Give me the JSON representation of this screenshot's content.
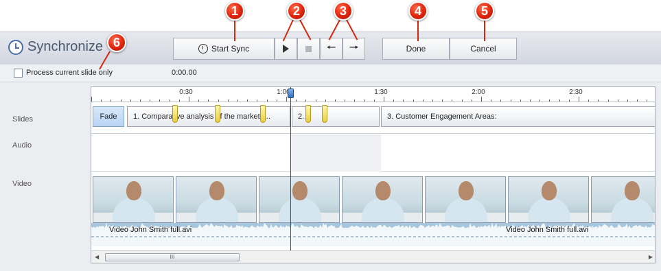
{
  "app": {
    "title": "Synchronize"
  },
  "toolbar": {
    "start_sync_label": "Start Sync",
    "done_label": "Done",
    "cancel_label": "Cancel"
  },
  "process": {
    "checkbox_label": "Process current slide only",
    "checked": false,
    "time": "0:00.00"
  },
  "callouts": [
    "1",
    "2",
    "3",
    "4",
    "5",
    "6"
  ],
  "tracks": {
    "slides": "Slides",
    "audio": "Audio",
    "video": "Video"
  },
  "ruler": {
    "labels": [
      "0:30",
      "1:00",
      "1:30",
      "2:00",
      "2:30"
    ]
  },
  "slides": [
    {
      "label": "Fade"
    },
    {
      "label": "1. Comparative analysis of the market f..."
    },
    {
      "label": "2."
    },
    {
      "label": "3. Customer Engagement Areas:"
    }
  ],
  "video": {
    "clip_labels": [
      "Video John Smith full.avi",
      "Video John Smith full.avi"
    ]
  },
  "scrollbar": {
    "grip": "III"
  },
  "colors": {
    "accent": "#4a6fa5",
    "callout": "#e0240d",
    "fade": "#b9d4f3",
    "waveform": "#a7c6dd",
    "marker": "#e9cf3f"
  }
}
